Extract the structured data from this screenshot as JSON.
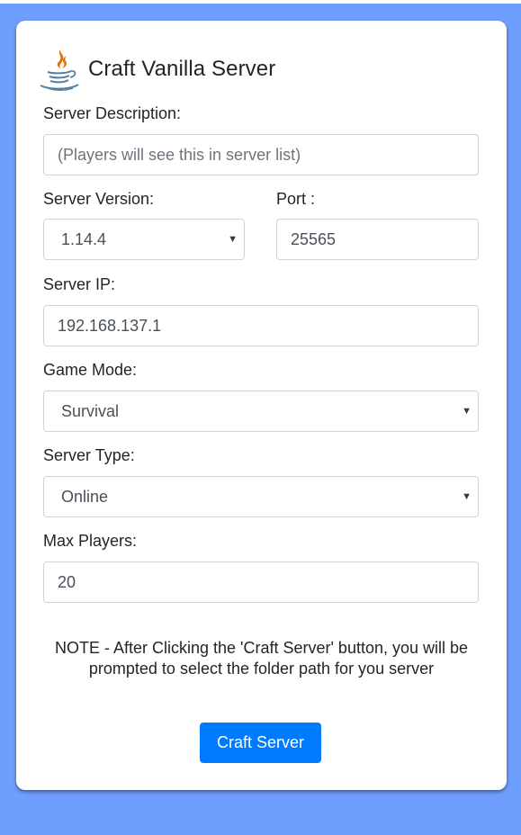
{
  "app": {
    "title": "Craft Vanilla Server",
    "logo_icon": "java-icon"
  },
  "form": {
    "description": {
      "label": "Server Description:",
      "value": "",
      "placeholder": "(Players will see this in server list)"
    },
    "version": {
      "label": "Server Version:",
      "value": "1.14.4"
    },
    "port": {
      "label": "Port :",
      "value": "25565"
    },
    "ip": {
      "label": "Server IP:",
      "value": "192.168.137.1"
    },
    "game_mode": {
      "label": "Game Mode:",
      "value": "Survival"
    },
    "server_type": {
      "label": "Server Type:",
      "value": "Online"
    },
    "max_players": {
      "label": "Max Players:",
      "value": "20"
    }
  },
  "note": {
    "prefix": "NOTE - ",
    "text": "After Clicking the 'Craft Server' button, you will be prompted to select the folder path for you server"
  },
  "actions": {
    "craft_label": "Craft Server"
  },
  "colors": {
    "background": "#6e9ffe",
    "primary": "#007bff",
    "card": "#ffffff"
  }
}
